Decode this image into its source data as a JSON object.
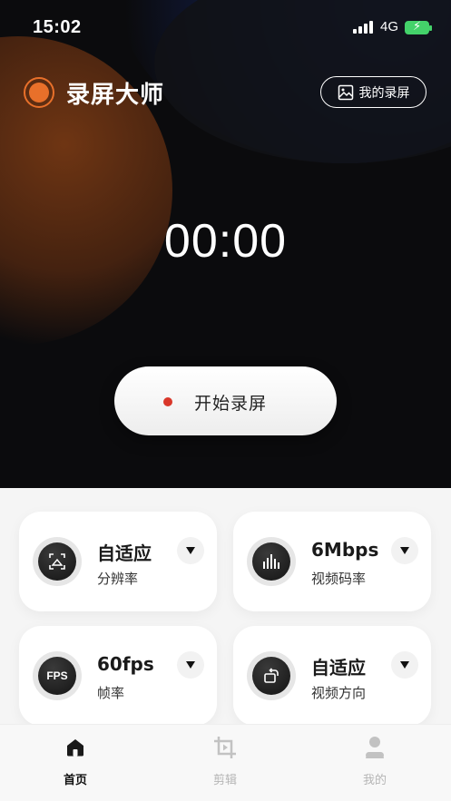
{
  "status_bar": {
    "time": "15:02",
    "network": "4G"
  },
  "app": {
    "title": "录屏大师",
    "my_records_label": "我的录屏",
    "accent": "#e8702a"
  },
  "recorder": {
    "timer": "00:00",
    "start_label": "开始录屏",
    "record_dot_color": "#d9372a"
  },
  "settings": [
    {
      "value": "自适应",
      "label": "分辨率",
      "icon": "resolution-icon"
    },
    {
      "value": "6Mbps",
      "label": "视频码率",
      "icon": "bitrate-icon"
    },
    {
      "value": "60fps",
      "label": "帧率",
      "icon": "fps-icon",
      "icon_text": "FPS"
    },
    {
      "value": "自适应",
      "label": "视频方向",
      "icon": "rotate-icon"
    }
  ],
  "tabs": [
    {
      "label": "首页",
      "icon": "home-icon",
      "active": true
    },
    {
      "label": "剪辑",
      "icon": "crop-icon",
      "active": false
    },
    {
      "label": "我的",
      "icon": "person-icon",
      "active": false
    }
  ]
}
